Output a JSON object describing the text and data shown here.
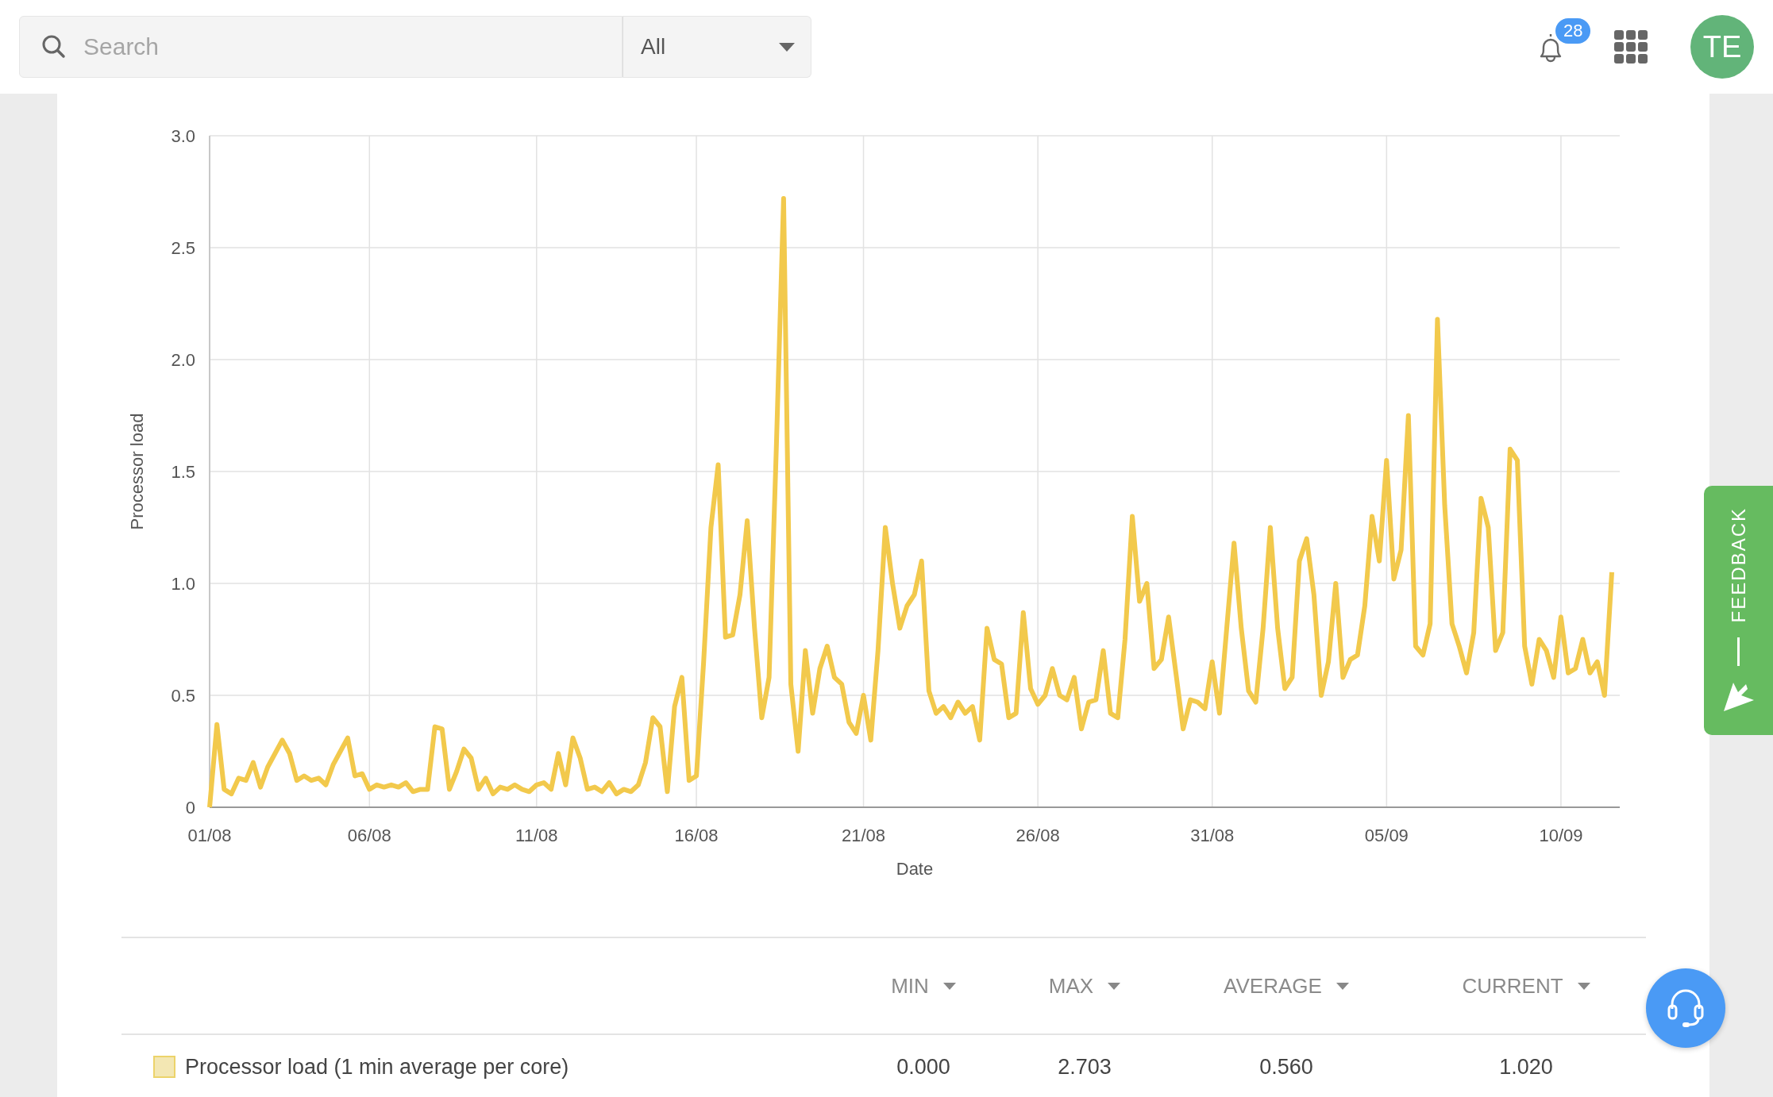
{
  "search": {
    "placeholder": "Search",
    "scope": "All"
  },
  "notifications": {
    "count": "28"
  },
  "user": {
    "initials": "TE"
  },
  "chart": {
    "chart_data": {
      "type": "line",
      "grid": true,
      "xlabel": "Date",
      "ylabel": "Processor load",
      "ylim": [
        0,
        3
      ],
      "categories": [
        "01/08",
        null,
        null,
        null,
        null,
        null,
        null,
        null,
        null,
        null,
        null,
        null,
        null,
        null,
        null,
        null,
        null,
        null,
        null,
        null,
        null,
        null,
        "06/08",
        null,
        null,
        null,
        null,
        null,
        null,
        null,
        null,
        null,
        null,
        null,
        null,
        null,
        null,
        null,
        null,
        null,
        null,
        null,
        null,
        null,
        null,
        "11/08",
        null,
        null,
        null,
        null,
        null,
        null,
        null,
        null,
        null,
        null,
        null,
        null,
        null,
        null,
        null,
        null,
        null,
        null,
        null,
        null,
        null,
        "16/08",
        null,
        null,
        null,
        null,
        null,
        null,
        null,
        null,
        null,
        null,
        null,
        null,
        null,
        null,
        null,
        null,
        null,
        null,
        null,
        null,
        null,
        null,
        "21/08",
        null,
        null,
        null,
        null,
        null,
        null,
        null,
        null,
        null,
        null,
        null,
        null,
        null,
        null,
        null,
        null,
        null,
        null,
        null,
        null,
        null,
        null,
        null,
        "26/08",
        null,
        null,
        null,
        null,
        null,
        null,
        null,
        null,
        null,
        null,
        null,
        null,
        null,
        null,
        null,
        null,
        null,
        null,
        null,
        null,
        null,
        null,
        null,
        "31/08",
        null,
        null,
        null,
        null,
        null,
        null,
        null,
        null,
        null,
        null,
        null,
        null,
        null,
        null,
        null,
        null,
        null,
        null,
        null,
        null,
        null,
        null,
        null,
        "05/09",
        null,
        null,
        null,
        null,
        null,
        null,
        null,
        null,
        null,
        null,
        null,
        null,
        null,
        null,
        null,
        null,
        null,
        null,
        null,
        null,
        null,
        null,
        null,
        "10/09",
        null,
        null,
        null,
        null,
        null,
        null,
        null
      ],
      "yticks": [
        {
          "value": 0,
          "label": "0"
        },
        {
          "value": 0.5,
          "label": "0.5"
        },
        {
          "value": 1,
          "label": "1.0"
        },
        {
          "value": 1.5,
          "label": "1.5"
        },
        {
          "value": 2,
          "label": "2.0"
        },
        {
          "value": 2.5,
          "label": "2.5"
        },
        {
          "value": 3,
          "label": "3.0"
        }
      ],
      "series": [
        {
          "name": "Processor load (1 min average per core)",
          "color": "#f2c94c",
          "values": [
            0,
            0.37,
            0.08,
            0.06,
            0.13,
            0.12,
            0.2,
            0.09,
            0.18,
            0.24,
            0.3,
            0.24,
            0.12,
            0.14,
            0.12,
            0.13,
            0.1,
            0.19,
            0.25,
            0.31,
            0.14,
            0.15,
            0.08,
            0.1,
            0.09,
            0.1,
            0.09,
            0.11,
            0.07,
            0.08,
            0.08,
            0.36,
            0.35,
            0.08,
            0.16,
            0.26,
            0.22,
            0.08,
            0.13,
            0.06,
            0.09,
            0.08,
            0.1,
            0.08,
            0.07,
            0.1,
            0.11,
            0.08,
            0.24,
            0.1,
            0.31,
            0.22,
            0.08,
            0.09,
            0.07,
            0.11,
            0.06,
            0.08,
            0.07,
            0.1,
            0.2,
            0.4,
            0.36,
            0.07,
            0.45,
            0.58,
            0.12,
            0.14,
            0.65,
            1.25,
            1.53,
            0.76,
            0.77,
            0.95,
            1.28,
            0.8,
            0.4,
            0.58,
            1.6,
            2.72,
            0.55,
            0.25,
            0.7,
            0.42,
            0.62,
            0.72,
            0.58,
            0.55,
            0.38,
            0.33,
            0.5,
            0.3,
            0.7,
            1.25,
            1.0,
            0.8,
            0.9,
            0.95,
            1.1,
            0.52,
            0.42,
            0.45,
            0.4,
            0.47,
            0.42,
            0.45,
            0.3,
            0.8,
            0.66,
            0.64,
            0.4,
            0.42,
            0.87,
            0.53,
            0.46,
            0.5,
            0.62,
            0.5,
            0.48,
            0.58,
            0.35,
            0.47,
            0.48,
            0.7,
            0.42,
            0.4,
            0.75,
            1.3,
            0.92,
            1.0,
            0.62,
            0.66,
            0.85,
            0.6,
            0.35,
            0.48,
            0.47,
            0.44,
            0.65,
            0.42,
            0.8,
            1.18,
            0.8,
            0.52,
            0.47,
            0.8,
            1.25,
            0.8,
            0.53,
            0.58,
            1.1,
            1.2,
            0.95,
            0.5,
            0.65,
            1.0,
            0.58,
            0.66,
            0.68,
            0.9,
            1.3,
            1.1,
            1.55,
            1.02,
            1.15,
            1.75,
            0.72,
            0.68,
            0.82,
            2.18,
            1.35,
            0.82,
            0.72,
            0.6,
            0.78,
            1.38,
            1.25,
            0.7,
            0.78,
            1.6,
            1.55,
            0.72,
            0.55,
            0.75,
            0.7,
            0.58,
            0.85,
            0.6,
            0.62,
            0.75,
            0.6,
            0.65,
            0.5,
            1.05
          ]
        }
      ]
    }
  },
  "stats_table": {
    "columns": [
      "MIN",
      "MAX",
      "AVERAGE",
      "CURRENT"
    ],
    "rows": [
      {
        "color": "#f3e7b3",
        "values": [
          "0.000",
          "2.703",
          "0.560",
          "1.020"
        ]
      }
    ]
  },
  "feedback": {
    "label": "FEEDBACK"
  }
}
